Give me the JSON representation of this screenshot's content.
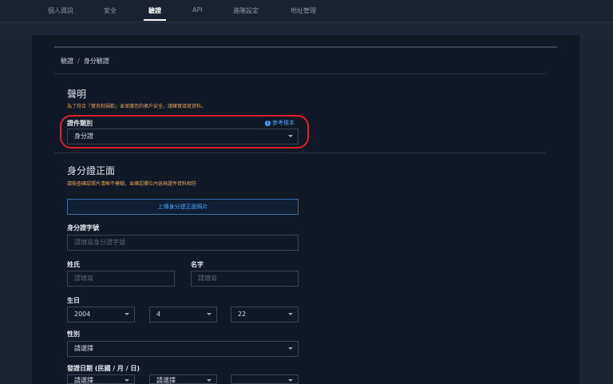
{
  "topnav": {
    "tabs": [
      {
        "label": "個人資訊"
      },
      {
        "label": "安全"
      },
      {
        "label": "驗證"
      },
      {
        "label": "API"
      },
      {
        "label": "進階設定"
      },
      {
        "label": "地址管理"
      }
    ]
  },
  "breadcrumb": {
    "parent": "驗證",
    "separator": "/",
    "current": "身分驗證"
  },
  "statement": {
    "title": "聲明",
    "note": "為了符合『實名制規範』並保護您的帳戶安全，請確實填寫資料。"
  },
  "id_type": {
    "label": "證件類別",
    "reference_link": "參考樣本",
    "reference_icon": "i",
    "value": "身分證"
  },
  "front": {
    "title": "身分證正面",
    "note": "請檢查確認照片清晰不模糊，並確認欄位內容與證件資料相符",
    "upload_label": "上傳身分證正面照片"
  },
  "id_number": {
    "label": "身分證字號",
    "placeholder": "請填寫身分證字號"
  },
  "surname": {
    "label": "姓氏",
    "placeholder": "請填寫"
  },
  "given_name": {
    "label": "名字",
    "placeholder": "請填寫"
  },
  "birthday": {
    "label": "生日",
    "year": "2004",
    "month": "4",
    "day": "22"
  },
  "gender": {
    "label": "性別",
    "value": "請選擇"
  },
  "issue_date": {
    "label": "發證日期 (民國 / 月 / 日)",
    "year": "請選擇",
    "month": "請選擇",
    "day": ""
  }
}
